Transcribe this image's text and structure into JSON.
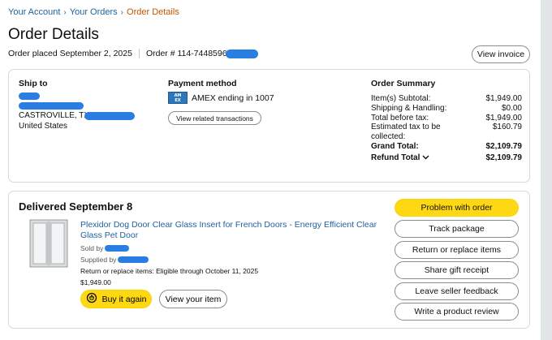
{
  "breadcrumb": {
    "items": [
      "Your Account",
      "Your Orders"
    ],
    "current": "Order Details",
    "separator": "›"
  },
  "page": {
    "title": "Order Details",
    "order_placed": "Order placed September 2, 2025",
    "order_number_prefix": "Order # 114-7448596",
    "invoice_button": "View invoice"
  },
  "ship_to": {
    "title": "Ship to",
    "city_line": "CASTROVILLE, TX",
    "country": "United States"
  },
  "payment": {
    "title": "Payment method",
    "card_logo_top": "AM",
    "card_logo_bottom": "EX",
    "card_text": "AMEX ending in 1007",
    "transactions_button": "View related transactions"
  },
  "summary": {
    "title": "Order Summary",
    "rows": [
      {
        "label": "Item(s) Subtotal:",
        "value": "$1,949.00"
      },
      {
        "label": "Shipping & Handling:",
        "value": "$0.00"
      },
      {
        "label": "Total before tax:",
        "value": "$1,949.00"
      },
      {
        "label": "Estimated tax to be collected:",
        "value": "$160.79"
      }
    ],
    "grand_total_label": "Grand Total:",
    "grand_total_value": "$2,109.79",
    "refund_total_label": "Refund Total",
    "refund_total_value": "$2,109.79"
  },
  "shipment": {
    "status": "Delivered September 8",
    "product_title": "Plexidor Dog Door Clear Glass Insert for French Doors - Energy Efficient Clear Glass Pet Door",
    "sold_by": "Sold by",
    "supplied_by": "Supplied by",
    "return_eligibility": "Return or replace items: Eligible through October 11, 2025",
    "price": "$1,949.00",
    "buy_again": "Buy it again",
    "view_item": "View your item"
  },
  "actions": [
    "Problem with order",
    "Track package",
    "Return or replace items",
    "Share gift receipt",
    "Leave seller feedback",
    "Write a product review"
  ],
  "colors": {
    "link": "#2162a1",
    "breadcrumb_current": "#c45500",
    "primary_button": "#ffd814",
    "redaction": "#2a7de1",
    "amex": "#2e77bc"
  }
}
